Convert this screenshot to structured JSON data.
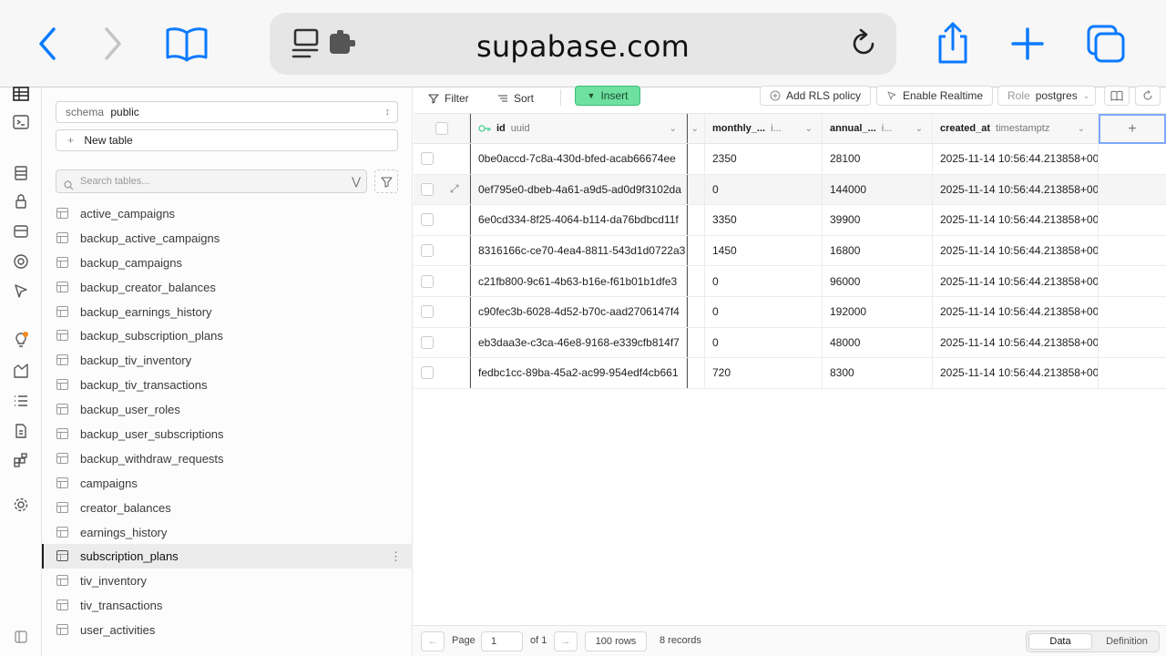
{
  "browser": {
    "url": "supabase.com"
  },
  "sidebar": {
    "schema_label": "schema",
    "schema_value": "public",
    "new_table": "New table",
    "search_placeholder": "Search tables...",
    "tables": [
      "active_campaigns",
      "backup_active_campaigns",
      "backup_campaigns",
      "backup_creator_balances",
      "backup_earnings_history",
      "backup_subscription_plans",
      "backup_tiv_inventory",
      "backup_tiv_transactions",
      "backup_user_roles",
      "backup_user_subscriptions",
      "backup_withdraw_requests",
      "campaigns",
      "creator_balances",
      "earnings_history",
      "subscription_plans",
      "tiv_inventory",
      "tiv_transactions",
      "user_activities"
    ],
    "active_table": "subscription_plans"
  },
  "toolbar": {
    "filter": "Filter",
    "sort": "Sort",
    "insert": "Insert",
    "add_rls": "Add RLS policy",
    "realtime": "Enable Realtime",
    "role_label": "Role",
    "role_value": "postgres"
  },
  "grid": {
    "columns": [
      {
        "name": "id",
        "type": "uuid"
      },
      {
        "name": "monthly_...",
        "type": "i..."
      },
      {
        "name": "annual_...",
        "type": "i..."
      },
      {
        "name": "created_at",
        "type": "timestamptz"
      }
    ],
    "rows": [
      {
        "id": "0be0accd-7c8a-430d-bfed-acab66674ee",
        "monthly": "2350",
        "annual": "28100",
        "created": "2025-11-14 10:56:44.213858+00"
      },
      {
        "id": "0ef795e0-dbeb-4a61-a9d5-ad0d9f3102da",
        "monthly": "0",
        "annual": "144000",
        "created": "2025-11-14 10:56:44.213858+00"
      },
      {
        "id": "6e0cd334-8f25-4064-b114-da76bdbcd11f",
        "monthly": "3350",
        "annual": "39900",
        "created": "2025-11-14 10:56:44.213858+00"
      },
      {
        "id": "8316166c-ce70-4ea4-8811-543d1d0722a3",
        "monthly": "1450",
        "annual": "16800",
        "created": "2025-11-14 10:56:44.213858+00"
      },
      {
        "id": "c21fb800-9c61-4b63-b16e-f61b01b1dfe3",
        "monthly": "0",
        "annual": "96000",
        "created": "2025-11-14 10:56:44.213858+00"
      },
      {
        "id": "c90fec3b-6028-4d52-b70c-aad2706147f4",
        "monthly": "0",
        "annual": "192000",
        "created": "2025-11-14 10:56:44.213858+00"
      },
      {
        "id": "eb3daa3e-c3ca-46e8-9168-e339cfb814f7",
        "monthly": "0",
        "annual": "48000",
        "created": "2025-11-14 10:56:44.213858+00"
      },
      {
        "id": "fedbc1cc-89ba-45a2-ac99-954edf4cb661",
        "monthly": "720",
        "annual": "8300",
        "created": "2025-11-14 10:56:44.213858+00"
      }
    ]
  },
  "footer": {
    "page_label": "Page",
    "page_value": "1",
    "of_label": "of 1",
    "rows_label": "100 rows",
    "records": "8 records",
    "tab_data": "Data",
    "tab_definition": "Definition"
  },
  "colors": {
    "accent": "#0a7aff",
    "insert_green": "#6ee0a0"
  }
}
